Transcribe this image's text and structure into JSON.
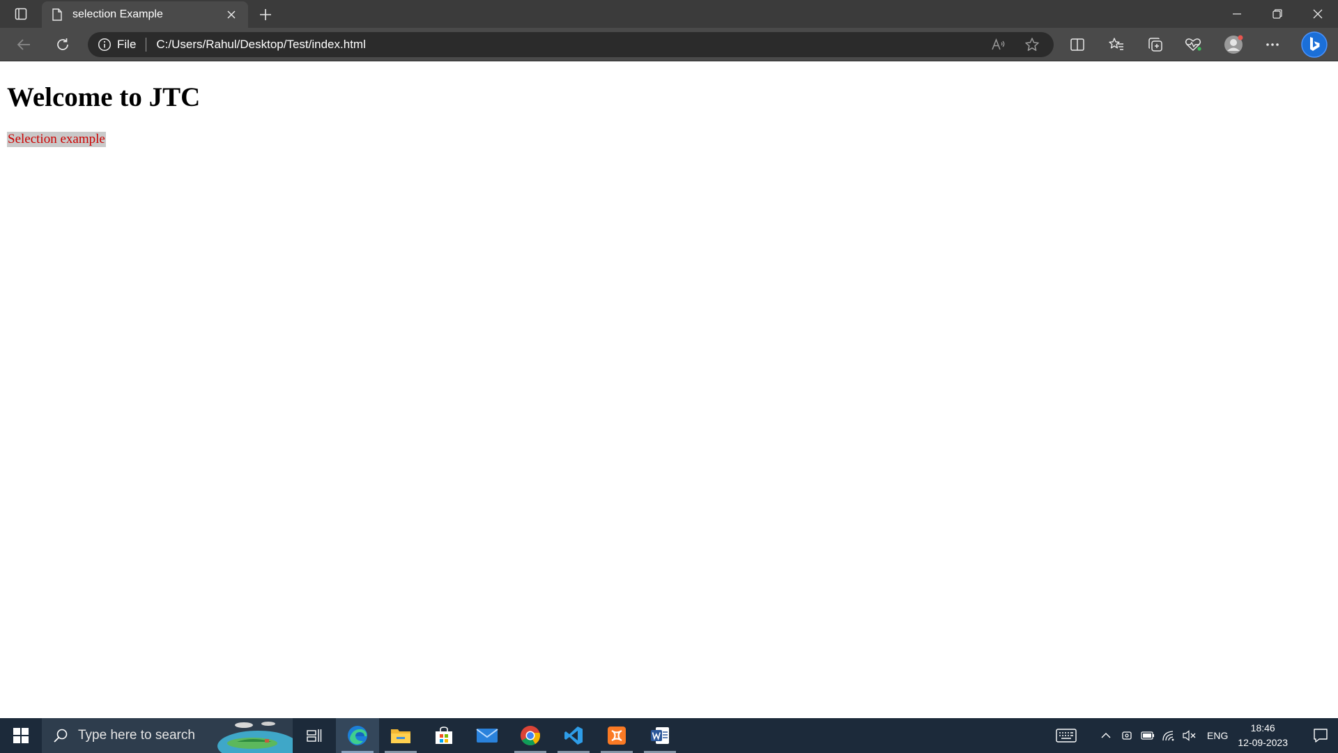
{
  "browser": {
    "tab": {
      "title": "selection Example"
    },
    "address": {
      "scheme_label": "File",
      "url": "C:/Users/Rahul/Desktop/Test/index.html"
    },
    "icons": [
      "tab-actions-icon",
      "document-icon",
      "close-icon",
      "plus-icon",
      "minimize-icon",
      "restore-icon",
      "close-icon",
      "back-icon",
      "refresh-icon",
      "info-icon",
      "read-aloud-icon",
      "favorite-star-icon",
      "split-screen-icon",
      "favorites-icon",
      "collections-icon",
      "browser-essentials-icon",
      "profile-icon",
      "more-icon",
      "bing-copilot-icon"
    ]
  },
  "page": {
    "heading": "Welcome to JTC",
    "paragraph": "Selection example",
    "paragraph_color": "#cc0000",
    "selection_bg": "#c9c9c9"
  },
  "taskbar": {
    "search_placeholder": "Type here to search",
    "apps": [
      "task-view",
      "edge",
      "file-explorer",
      "microsoft-store",
      "mail",
      "chrome",
      "vscode",
      "xampp",
      "word"
    ],
    "tray": {
      "language": "ENG",
      "time": "18:46",
      "date": "12-09-2023"
    }
  }
}
